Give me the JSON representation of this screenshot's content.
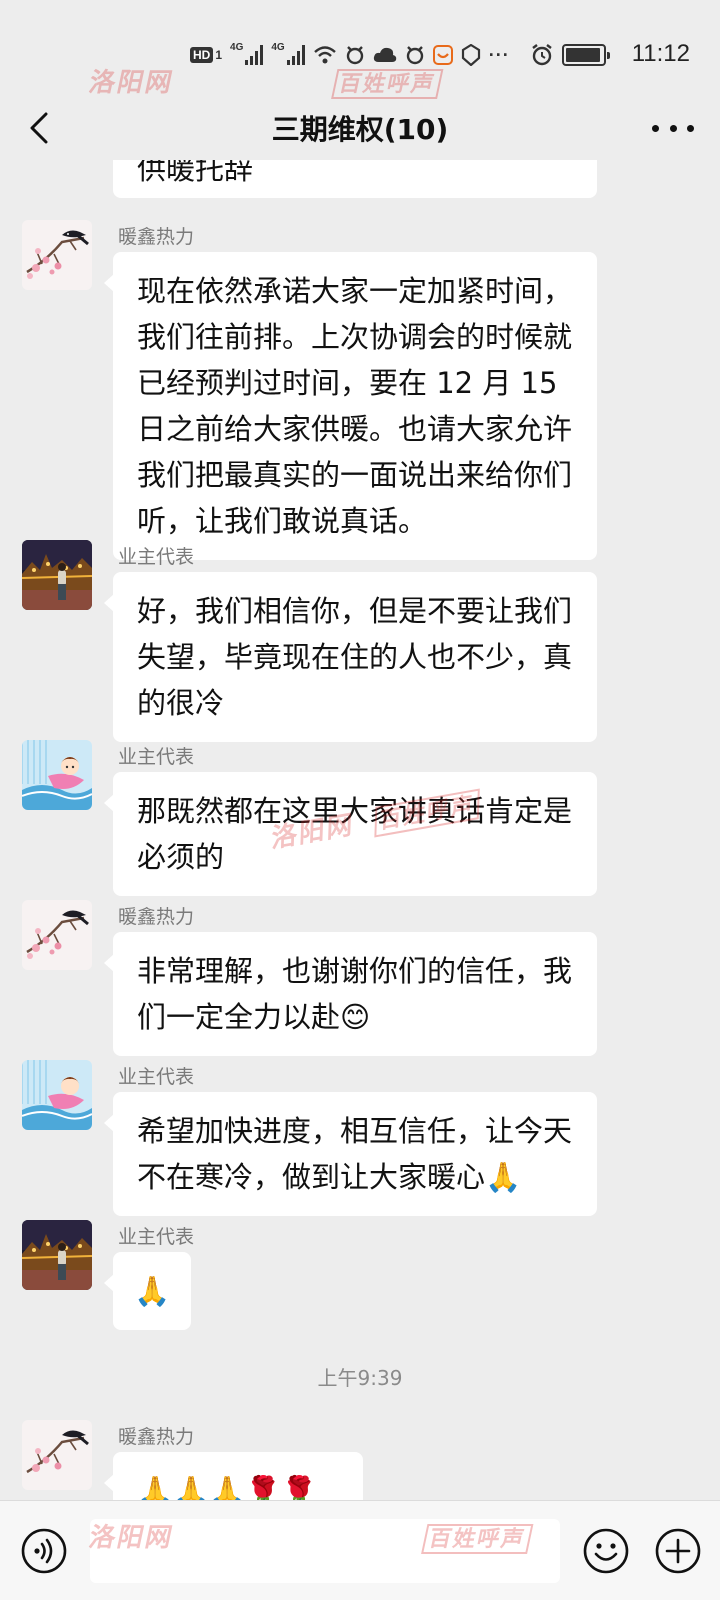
{
  "status_bar": {
    "hd_label": "HD",
    "hd_sub": "1",
    "net1": "4G",
    "net2": "4G",
    "time": "11:12",
    "icons": [
      "hd-icon",
      "signal-icon",
      "wifi-icon",
      "alarm-app-icon",
      "cloud-icon",
      "notification-icon",
      "shield-icon",
      "more-icon",
      "alarm-icon",
      "battery-icon"
    ],
    "battery_level": 0.95
  },
  "watermark": {
    "top_text": "洛阳网",
    "top_box": "百姓呼声",
    "middle_text": "洛阳网",
    "middle_box": "百姓呼声",
    "bottom_text": "洛阳网",
    "bottom_box": "百姓呼声"
  },
  "header": {
    "title": "三期维权(10)",
    "back_icon": "chevron-left-icon",
    "menu_icon": "ellipsis-icon"
  },
  "messages": [
    {
      "sender": "",
      "text": "供暖托辞",
      "avatar": "",
      "partial": true
    },
    {
      "sender": "暖鑫热力",
      "avatar": "plum-blossom-avatar",
      "text": "现在依然承诺大家一定加紧时间，我们往前排。上次协调会的时候就已经预判过时间，要在 12 月 15 日之前给大家供暖。也请大家允许我们把最真实的一面说出来给你们听，让我们敢说真话。"
    },
    {
      "sender": "业主代表",
      "avatar": "night-city-avatar",
      "text": "好，我们相信你，但是不要让我们失望，毕竟现在住的人也不少，真的很冷"
    },
    {
      "sender": "业主代表",
      "avatar": "cartoon-girl-avatar",
      "text": "那既然都在这里大家讲真话肯定是必须的"
    },
    {
      "sender": "暖鑫热力",
      "avatar": "plum-blossom-avatar",
      "text": "非常理解，也谢谢你们的信任，我们一定全力以赴😊"
    },
    {
      "sender": "业主代表",
      "avatar": "cartoon-girl-avatar",
      "text": "希望加快进度，相互信任，让今天不在寒冷，做到让大家暖心🙏"
    },
    {
      "sender": "业主代表",
      "avatar": "night-city-avatar",
      "text": "🙏"
    },
    {
      "sender": "暖鑫热力",
      "avatar": "plum-blossom-avatar",
      "text": "🙏🙏🙏🌹🌹🌹"
    }
  ],
  "time_separator": "上午9:39",
  "input_bar": {
    "voice_icon": "voice-icon",
    "emoji_icon": "emoji-icon",
    "plus_icon": "plus-icon",
    "placeholder": ""
  },
  "colors": {
    "background": "#ededed",
    "bubble": "#ffffff",
    "sender_name": "#7a7a7a",
    "watermark": "#d62828"
  }
}
